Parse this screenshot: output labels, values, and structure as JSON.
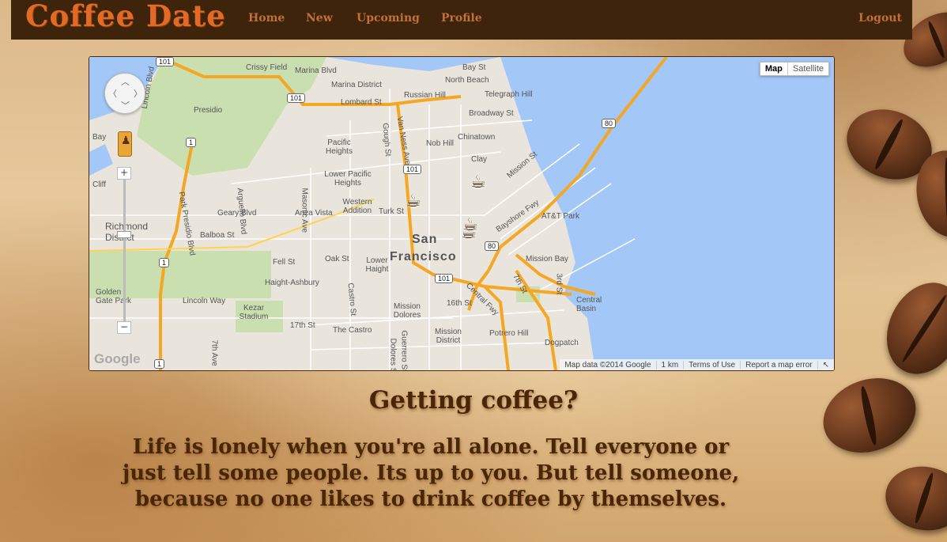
{
  "nav": {
    "brand": "Coffee Date",
    "links": [
      "Home",
      "New",
      "Upcoming",
      "Profile"
    ],
    "logout": "Logout"
  },
  "map": {
    "types": {
      "map": "Map",
      "satellite": "Satellite"
    },
    "zoom_in": "+",
    "zoom_out": "−",
    "google": "Google",
    "attribution": {
      "data": "Map data ©2014 Google",
      "scale": "1 km",
      "terms": "Terms of Use",
      "report": "Report a map error"
    },
    "city_label": [
      "San",
      "Francisco"
    ],
    "labels": [
      "Marina Blvd",
      "Marina District",
      "Crissy Field",
      "Russian Hill",
      "North Beach",
      "Telegraph Hill",
      "Bay St",
      "Lombard St",
      "Presidio",
      "Broadway St",
      "Van Ness Ave",
      "Gough St",
      "Nob Hill",
      "Chinatown",
      "Pacific Heights",
      "Lower Pacific Heights",
      "Western Addition",
      "Anza Vista",
      "Geary Blvd",
      "Balboa St",
      "Turk St",
      "Richmond District",
      "Fell St",
      "Oak St",
      "Lower Haight",
      "Haight-Ashbury",
      "Golden Gate Park",
      "Lincoln Way",
      "Kezar Stadium",
      "17th St",
      "The Castro",
      "Mission Dolores",
      "Mission District",
      "16th St",
      "Central Fwy",
      "Potrero Hill",
      "Dogpatch",
      "Mission Bay",
      "AT&T Park",
      "Central Basin",
      "Bayshore Fwy",
      "Mission St",
      "3rd St",
      "7th St",
      "Masonic Ave",
      "Castro St",
      "Guerrero St",
      "Dolores St",
      "Park Presidio Blvd",
      "Lincoln Blvd",
      "Arguello Blvd",
      "7th Ave",
      "Clay",
      "Bay",
      "Cliff"
    ],
    "shields": [
      "101",
      "1",
      "80"
    ]
  },
  "headline": "Getting coffee?",
  "tagline": "Life is lonely when you're all alone. Tell everyone or just tell some people. Its up to you. But tell someone, because no one likes to drink coffee by themselves."
}
